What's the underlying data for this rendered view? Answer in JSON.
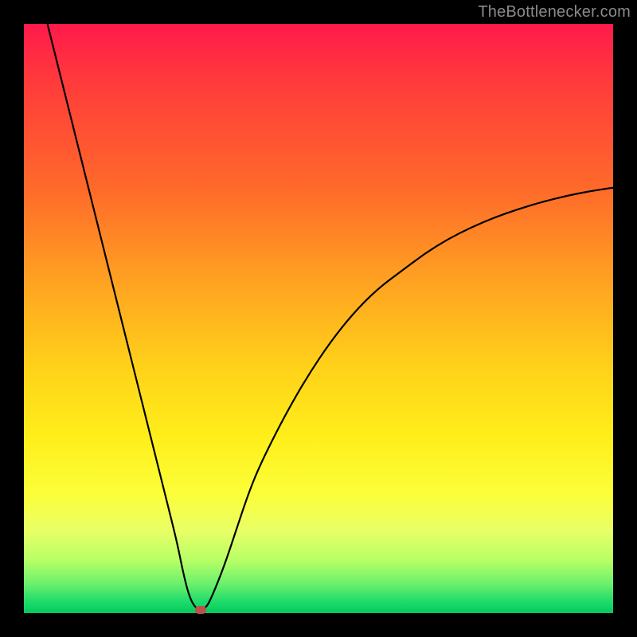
{
  "watermark": "TheBottlenecker.com",
  "colors": {
    "frame": "#000000",
    "curve": "#000000",
    "marker": "#b9524d",
    "gradient_top": "#ff1a4b",
    "gradient_bottom": "#04c95e"
  },
  "chart_data": {
    "type": "line",
    "title": "",
    "xlabel": "",
    "ylabel": "",
    "xlim": [
      0,
      100
    ],
    "ylim": [
      0,
      100
    ],
    "x": [
      4,
      6,
      8,
      10,
      12,
      14,
      16,
      18,
      20,
      22,
      24,
      26,
      27,
      28,
      29,
      30,
      31,
      32,
      34,
      36,
      38,
      40,
      44,
      48,
      52,
      56,
      60,
      64,
      68,
      72,
      76,
      80,
      84,
      88,
      92,
      96,
      100
    ],
    "values": [
      100,
      92,
      84,
      76,
      68,
      60,
      52,
      44,
      36,
      28,
      20,
      12,
      7,
      3,
      1,
      0.5,
      1,
      3,
      8,
      14,
      20,
      25,
      33,
      40,
      46,
      51,
      55,
      58,
      61,
      63.5,
      65.5,
      67.2,
      68.6,
      69.8,
      70.8,
      71.6,
      72.2
    ],
    "marker": {
      "x": 30,
      "y": 0.5
    },
    "grid": false,
    "legend": false
  }
}
